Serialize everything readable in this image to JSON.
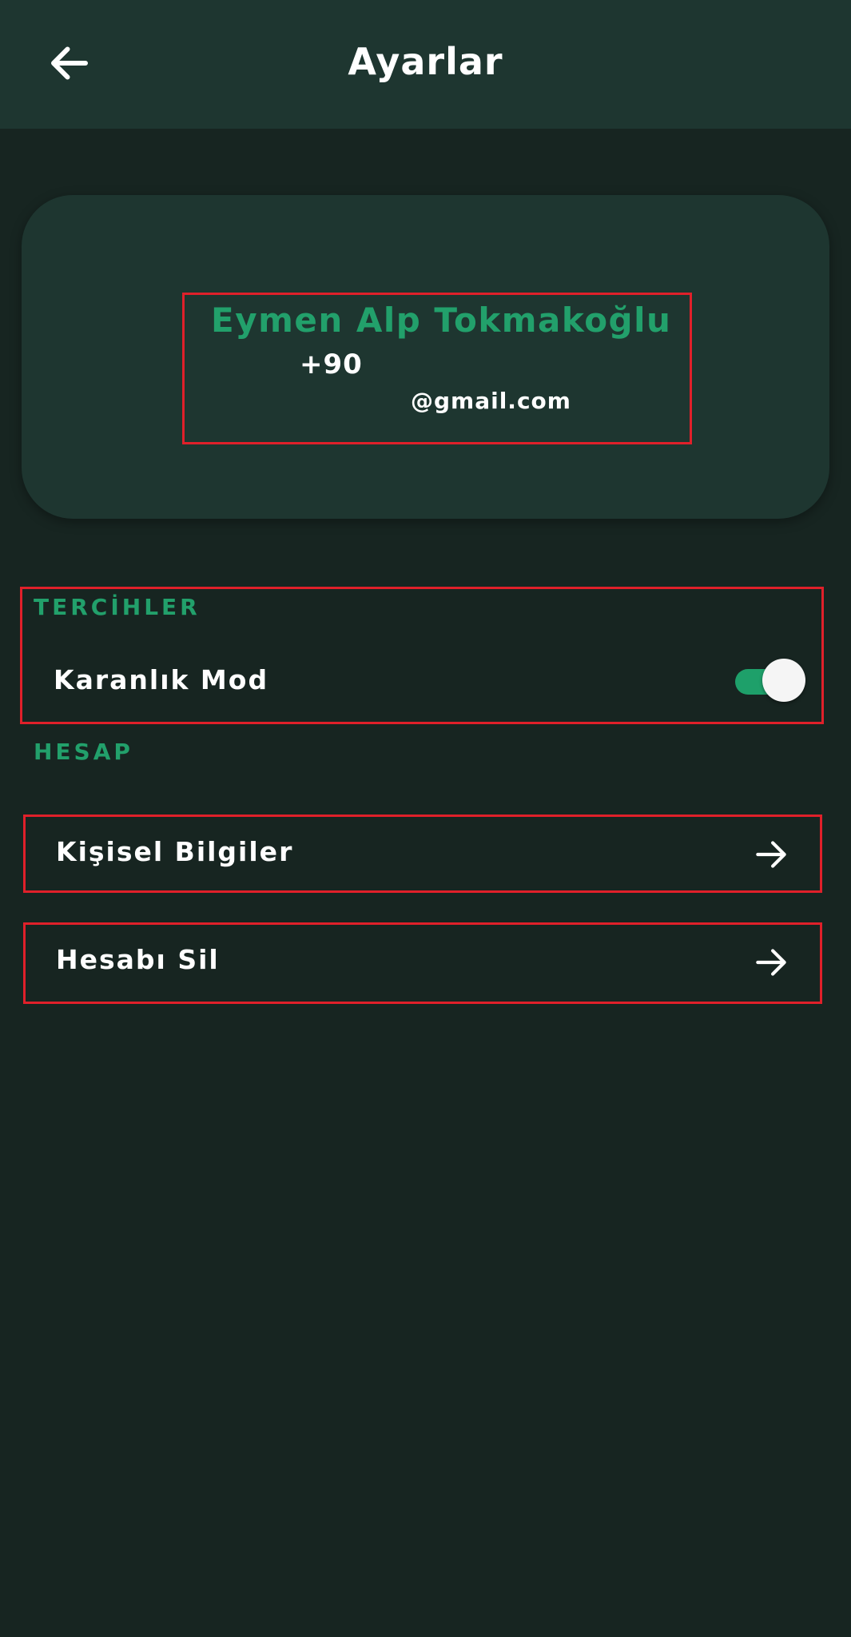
{
  "header": {
    "title": "Ayarlar",
    "back_icon": "arrow-left-icon"
  },
  "profile": {
    "name": "Eymen Alp Tokmakoğlu",
    "phone": "+90",
    "email": "@gmail.com"
  },
  "preferences": {
    "section_title": "TERCİHLER",
    "dark_mode": {
      "label": "Karanlık Mod",
      "enabled": true
    }
  },
  "account": {
    "section_title": "HESAP",
    "items": [
      {
        "label": "Kişisel Bilgiler",
        "icon": "arrow-right-icon"
      },
      {
        "label": "Hesabı Sil",
        "icon": "arrow-right-icon"
      }
    ]
  },
  "colors": {
    "background": "#172521",
    "surface": "#1e3630",
    "accent": "#22a06b",
    "highlight_border": "#e0202a"
  }
}
